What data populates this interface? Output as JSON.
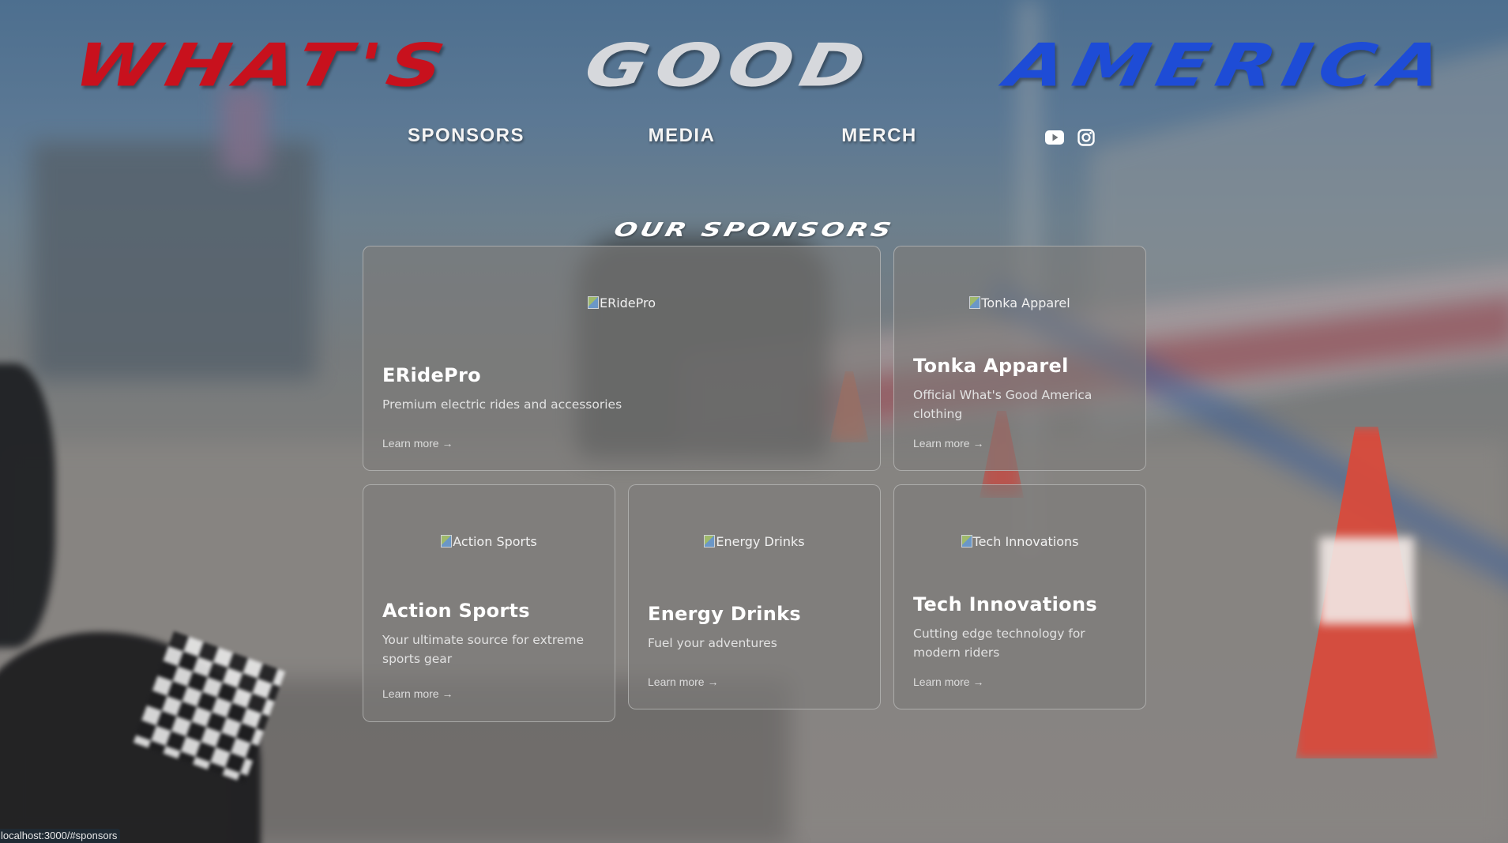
{
  "header": {
    "logo_words": [
      "WHAT'S",
      "GOOD",
      "AMERICA"
    ],
    "logo_colors": [
      "#c8111d",
      "#d6d8dc",
      "#1e4cd6"
    ]
  },
  "nav": {
    "items": [
      {
        "label": "SPONSORS"
      },
      {
        "label": "MEDIA"
      },
      {
        "label": "MERCH"
      }
    ],
    "social_icons": [
      "youtube-icon",
      "instagram-icon"
    ]
  },
  "section": {
    "title": "OUR SPONSORS"
  },
  "sponsors": [
    {
      "image_alt": "ERidePro",
      "name": "ERidePro",
      "description": "Premium electric rides and accessories",
      "link": "Learn more →"
    },
    {
      "image_alt": "Tonka Apparel",
      "name": "Tonka Apparel",
      "description": "Official What's Good America clothing",
      "link": "Learn more →"
    },
    {
      "image_alt": "Action Sports",
      "name": "Action Sports",
      "description": "Your ultimate source for extreme sports gear",
      "link": "Learn more →"
    },
    {
      "image_alt": "Energy Drinks",
      "name": "Energy Drinks",
      "description": "Fuel your adventures",
      "link": "Learn more →"
    },
    {
      "image_alt": "Tech Innovations",
      "name": "Tech Innovations",
      "description": "Cutting edge technology for modern riders",
      "link": "Learn more →"
    }
  ],
  "status_bar": {
    "url": "localhost:3000/#sponsors"
  }
}
